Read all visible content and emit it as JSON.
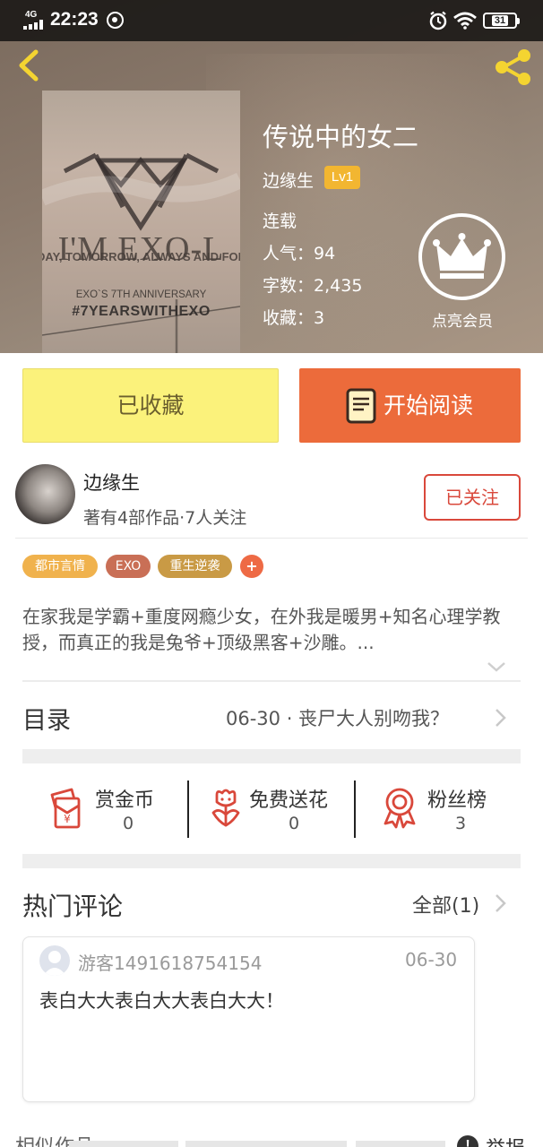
{
  "status_bar": {
    "network": "4G",
    "time": "22:23",
    "battery": "31"
  },
  "book": {
    "title": "传说中的女二",
    "author": "边缘生",
    "author_level": "Lv1",
    "status": "连载",
    "popularity_label": "人气：",
    "popularity": "94",
    "words_label": "字数：",
    "words": "2,435",
    "favorites_label": "收藏：",
    "favorites": "3",
    "cover": {
      "line1": "I'M EXO-L",
      "line2": "DAY, TOMORROW, ALWAYS AND FOREVER",
      "line3": "EXO`S 7TH ANNIVERSARY",
      "line4": "#7YEARSWITHEXO"
    }
  },
  "vip": {
    "label": "点亮会员",
    "icon": "crown-icon"
  },
  "actions": {
    "favorited_label": "已收藏",
    "read_label": "开始阅读"
  },
  "author_card": {
    "name": "边缘生",
    "stats": "著有4部作品·7人关注",
    "follow_label": "已关注"
  },
  "tags": [
    "都市言情",
    "EXO",
    "重生逆袭",
    "+"
  ],
  "synopsis": "在家我是学霸+重度网瘾少女，在外我是暖男+知名心理学教授，而真正的我是兔爷+顶级黑客+沙雕。...",
  "toc": {
    "title": "目录",
    "latest": "06-30 · 丧尸大人别吻我？"
  },
  "rewards": [
    {
      "label": "赏金币",
      "value": "0",
      "icon": "red-envelope-icon"
    },
    {
      "label": "免费送花",
      "value": "0",
      "icon": "flower-icon"
    },
    {
      "label": "粉丝榜",
      "value": "3",
      "icon": "medal-icon"
    }
  ],
  "comments": {
    "title": "热门评论",
    "all_label": "全部(1)",
    "items": [
      {
        "user": "游客1491618754154",
        "date": "06-30",
        "text": "表白大大表白大大表白大大！"
      }
    ]
  },
  "similar": {
    "title": "相似作品",
    "report_label": "举报"
  },
  "colors": {
    "accent_orange": "#ec6b3b",
    "favorite_yellow": "#fbf27b",
    "follow_red": "#d9483b",
    "level_badge": "#f2b631"
  }
}
